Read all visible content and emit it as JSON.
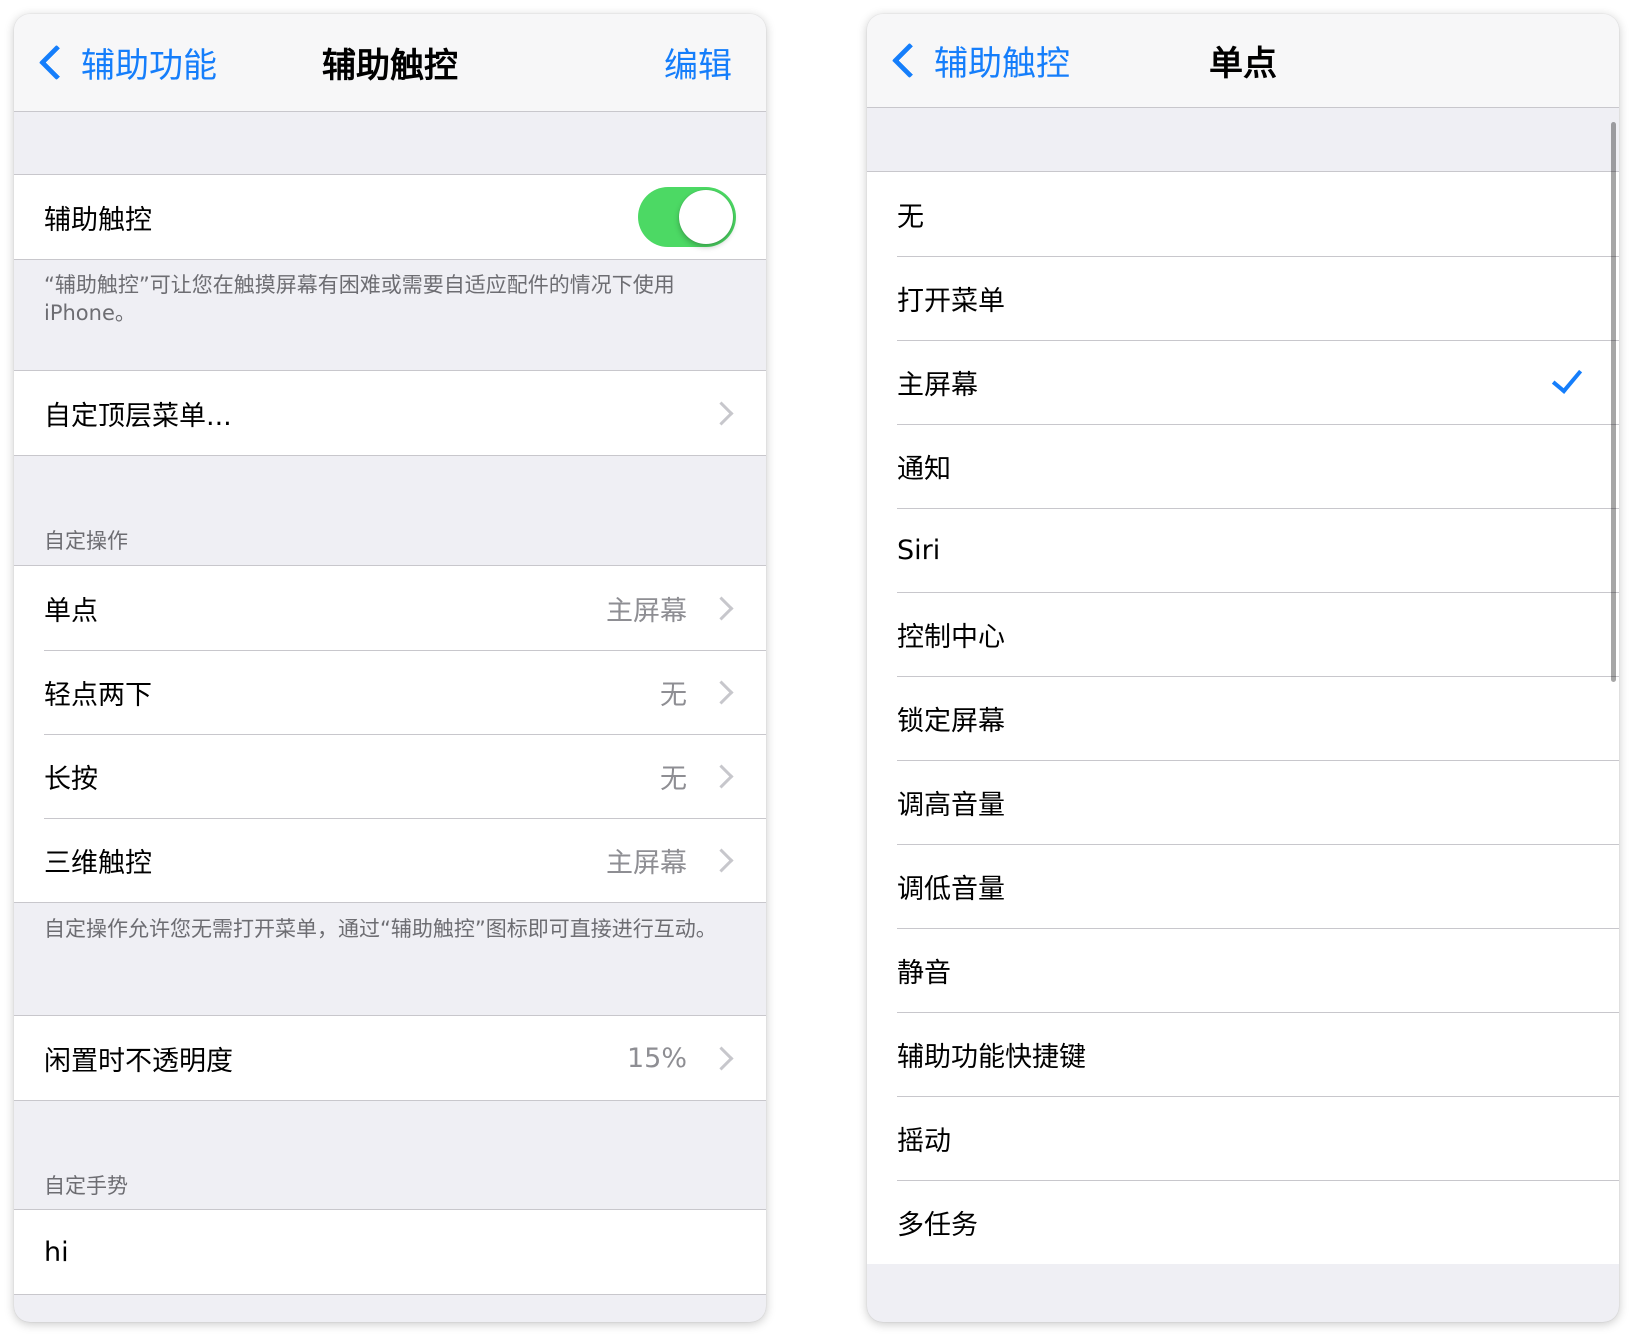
{
  "left": {
    "nav": {
      "back_label": "辅助功能",
      "title": "辅助触控",
      "edit_label": "编辑"
    },
    "assistive_touch": {
      "label": "辅助触控",
      "toggle_on": true,
      "footer": "“辅助触控”可让您在触摸屏幕有困难或需要自适应配件的情况下使用 iPhone。"
    },
    "customize_menu": {
      "label": "自定顶层菜单..."
    },
    "custom_actions": {
      "header": "自定操作",
      "items": [
        {
          "label": "单点",
          "value": "主屏幕"
        },
        {
          "label": "轻点两下",
          "value": "无"
        },
        {
          "label": "长按",
          "value": "无"
        },
        {
          "label": "三维触控",
          "value": "主屏幕"
        }
      ],
      "footer": "自定操作允许您无需打开菜单，通过“辅助触控”图标即可直接进行互动。"
    },
    "idle_opacity": {
      "label": "闲置时不透明度",
      "value": "15%"
    },
    "custom_gestures": {
      "header": "自定手势",
      "items": [
        {
          "label": "hi"
        }
      ]
    }
  },
  "right": {
    "nav": {
      "back_label": "辅助触控",
      "title": "单点"
    },
    "options": [
      {
        "label": "无",
        "selected": false
      },
      {
        "label": "打开菜单",
        "selected": false
      },
      {
        "label": "主屏幕",
        "selected": true
      },
      {
        "label": "通知",
        "selected": false
      },
      {
        "label": "Siri",
        "selected": false
      },
      {
        "label": "控制中心",
        "selected": false
      },
      {
        "label": "锁定屏幕",
        "selected": false
      },
      {
        "label": "调高音量",
        "selected": false
      },
      {
        "label": "调低音量",
        "selected": false
      },
      {
        "label": "静音",
        "selected": false
      },
      {
        "label": "辅助功能快捷键",
        "selected": false
      },
      {
        "label": "摇动",
        "selected": false
      },
      {
        "label": "多任务",
        "selected": false
      }
    ]
  },
  "colors": {
    "accent": "#157efb",
    "toggle_on": "#4cd964",
    "background": "#efeff4",
    "secondary_text": "#8e8e93"
  }
}
